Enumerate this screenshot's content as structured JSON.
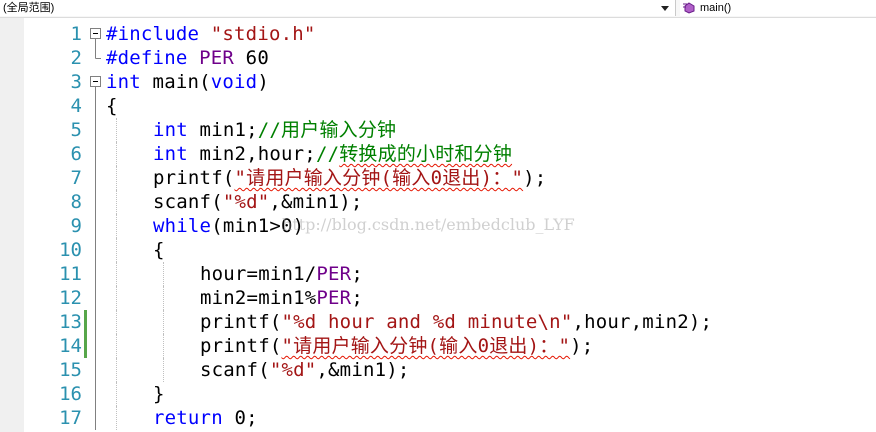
{
  "navigation_bar": {
    "scope_label": "(全局范围)",
    "member_label": "main()",
    "member_icon": "method-icon"
  },
  "watermark": "http://blog.csdn.net/embedclub_LYF",
  "colors": {
    "keyword": "#0000ff",
    "string": "#a31515",
    "comment": "#008000",
    "macro": "#6f008a",
    "line_number": "#2b91af",
    "changed_saved": "#57a64a"
  },
  "lines": [
    {
      "n": "1",
      "fold": "open",
      "indent": 0,
      "tokens": [
        {
          "t": "#include ",
          "c": "kw"
        },
        {
          "t": "\"stdio.h\"",
          "c": "str"
        }
      ]
    },
    {
      "n": "2",
      "fold": "end",
      "indent": 0,
      "tokens": [
        {
          "t": "#define ",
          "c": "kw"
        },
        {
          "t": "PER",
          "c": "mac"
        },
        {
          "t": " 60",
          "c": "txt"
        }
      ]
    },
    {
      "n": "3",
      "fold": "open",
      "indent": 0,
      "tokens": [
        {
          "t": "int",
          "c": "kw"
        },
        {
          "t": " main(",
          "c": "txt"
        },
        {
          "t": "void",
          "c": "kw"
        },
        {
          "t": ")",
          "c": "txt"
        }
      ]
    },
    {
      "n": "4",
      "fold": "line",
      "indent": 0,
      "tokens": [
        {
          "t": "{",
          "c": "txt"
        }
      ]
    },
    {
      "n": "5",
      "fold": "line",
      "indent": 1,
      "tokens": [
        {
          "t": "int",
          "c": "kw"
        },
        {
          "t": " min1;",
          "c": "txt"
        },
        {
          "t": "//用户输入分钟",
          "c": "cm"
        }
      ]
    },
    {
      "n": "6",
      "fold": "line",
      "indent": 1,
      "tokens": [
        {
          "t": "int",
          "c": "kw"
        },
        {
          "t": " min2,hour;",
          "c": "txt"
        },
        {
          "t": "//",
          "c": "cm"
        },
        {
          "t": "转换成的小时和分钟",
          "c": "cm",
          "sq": true
        }
      ]
    },
    {
      "n": "7",
      "fold": "line",
      "indent": 1,
      "tokens": [
        {
          "t": "printf(",
          "c": "txt"
        },
        {
          "t": "\"请用户输入分钟(输入0退出)：\"",
          "c": "str",
          "sq": true
        },
        {
          "t": ");",
          "c": "txt"
        }
      ]
    },
    {
      "n": "8",
      "fold": "line",
      "indent": 1,
      "tokens": [
        {
          "t": "scanf(",
          "c": "txt"
        },
        {
          "t": "\"%d\"",
          "c": "str"
        },
        {
          "t": ",&min1);",
          "c": "txt"
        }
      ]
    },
    {
      "n": "9",
      "fold": "line",
      "indent": 1,
      "tokens": [
        {
          "t": "while",
          "c": "kw"
        },
        {
          "t": "(min1>0)",
          "c": "txt"
        }
      ]
    },
    {
      "n": "10",
      "fold": "line",
      "indent": 1,
      "tokens": [
        {
          "t": "{",
          "c": "txt"
        }
      ]
    },
    {
      "n": "11",
      "fold": "line",
      "indent": 2,
      "tokens": [
        {
          "t": "hour=min1/",
          "c": "txt"
        },
        {
          "t": "PER",
          "c": "mac"
        },
        {
          "t": ";",
          "c": "txt"
        }
      ]
    },
    {
      "n": "12",
      "fold": "line",
      "indent": 2,
      "tokens": [
        {
          "t": "min2=min1%",
          "c": "txt"
        },
        {
          "t": "PER",
          "c": "mac"
        },
        {
          "t": ";",
          "c": "txt"
        }
      ]
    },
    {
      "n": "13",
      "fold": "line",
      "indent": 2,
      "changed": true,
      "tokens": [
        {
          "t": "printf(",
          "c": "txt"
        },
        {
          "t": "\"%d hour and %d minute\\n\"",
          "c": "str"
        },
        {
          "t": ",hour,min2);",
          "c": "txt"
        }
      ]
    },
    {
      "n": "14",
      "fold": "line",
      "indent": 2,
      "changed": true,
      "tokens": [
        {
          "t": "printf(",
          "c": "txt"
        },
        {
          "t": "\"请用户输入分钟(输入0退出)：\"",
          "c": "str",
          "sq": true
        },
        {
          "t": ");",
          "c": "txt"
        }
      ]
    },
    {
      "n": "15",
      "fold": "line",
      "indent": 2,
      "tokens": [
        {
          "t": "scanf(",
          "c": "txt"
        },
        {
          "t": "\"%d\"",
          "c": "str"
        },
        {
          "t": ",&min1);",
          "c": "txt"
        }
      ]
    },
    {
      "n": "16",
      "fold": "line",
      "indent": 1,
      "tokens": [
        {
          "t": "}",
          "c": "txt"
        }
      ]
    },
    {
      "n": "17",
      "fold": "line",
      "indent": 1,
      "tokens": [
        {
          "t": "return",
          "c": "kw"
        },
        {
          "t": " 0;",
          "c": "txt"
        }
      ]
    }
  ]
}
